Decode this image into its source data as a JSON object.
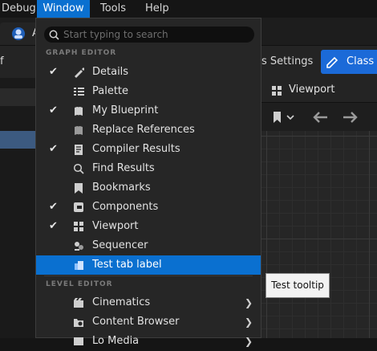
{
  "menubar": {
    "debug": "Debug",
    "window": "Window",
    "tools": "Tools",
    "help": "Help"
  },
  "tab": {
    "label": "A"
  },
  "toolbar": {
    "settings": "s Settings",
    "class_btn": "Class D",
    "f_fragment": "f"
  },
  "viewport": {
    "title": "Viewport"
  },
  "search": {
    "placeholder": "Start typing to search"
  },
  "menu": {
    "section_graph": "GRAPH EDITOR",
    "section_level": "LEVEL EDITOR",
    "items": [
      {
        "label": "Details",
        "checked": true,
        "icon": "details-icon"
      },
      {
        "label": "Palette",
        "checked": false,
        "icon": "palette-icon"
      },
      {
        "label": "My Blueprint",
        "checked": true,
        "icon": "blueprint-icon"
      },
      {
        "label": "Replace References",
        "checked": false,
        "icon": "replace-icon"
      },
      {
        "label": "Compiler Results",
        "checked": true,
        "icon": "compiler-icon"
      },
      {
        "label": "Find Results",
        "checked": false,
        "icon": "search-icon"
      },
      {
        "label": "Bookmarks",
        "checked": false,
        "icon": "bookmark-icon"
      },
      {
        "label": "Components",
        "checked": true,
        "icon": "components-icon"
      },
      {
        "label": "Viewport",
        "checked": true,
        "icon": "viewport-icon"
      },
      {
        "label": "Sequencer",
        "checked": false,
        "icon": "sequencer-icon"
      },
      {
        "label": "Test tab label",
        "checked": false,
        "icon": "test-tab-icon",
        "highlighted": true
      }
    ],
    "level_items": [
      {
        "label": "Cinematics",
        "icon": "cinematics-icon",
        "submenu": true
      },
      {
        "label": "Content Browser",
        "icon": "content-browser-icon",
        "submenu": true
      },
      {
        "label": "Lo Media",
        "icon": "media-icon",
        "submenu": true
      }
    ],
    "check_glyph": "✔",
    "arrow_glyph": "❯"
  },
  "tooltip": {
    "text": "Test tooltip"
  },
  "colors": {
    "accent": "#0a70d0",
    "menu_bg": "#262626",
    "tooltip_bg": "#f2f2f2"
  }
}
